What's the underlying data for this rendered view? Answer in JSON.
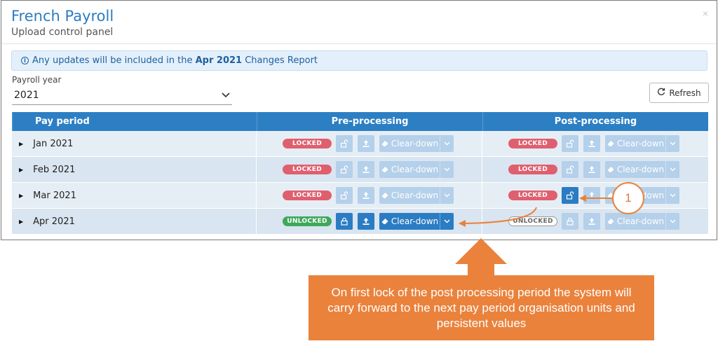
{
  "window": {
    "title": "French Payroll",
    "subtitle": "Upload control panel",
    "close_glyph": "×"
  },
  "banner": {
    "icon": "info-icon",
    "prefix": "Any updates will be included in the",
    "period": "Apr 2021",
    "suffix": "Changes Report"
  },
  "payroll_year": {
    "label": "Payroll year",
    "value": "2021"
  },
  "refresh_label": "Refresh",
  "table": {
    "headers": [
      "Pay period",
      "Pre-processing",
      "Post-processing"
    ],
    "rows": [
      {
        "period": "Jan 2021",
        "pre": {
          "status": "LOCKED",
          "cleardown": "Clear-down"
        },
        "post": {
          "status": "LOCKED",
          "cleardown": "Clear-down"
        }
      },
      {
        "period": "Feb 2021",
        "pre": {
          "status": "LOCKED",
          "cleardown": "Clear-down"
        },
        "post": {
          "status": "LOCKED",
          "cleardown": "Clear-down"
        }
      },
      {
        "period": "Mar 2021",
        "pre": {
          "status": "LOCKED",
          "cleardown": "Clear-down"
        },
        "post": {
          "status": "LOCKED",
          "cleardown": "Clear-down",
          "cleardown_partial": "own"
        }
      },
      {
        "period": "Apr 2021",
        "pre": {
          "status": "UNLOCKED",
          "cleardown": "Clear-down"
        },
        "post": {
          "status": "UNLOCKED",
          "cleardown": "Clear-down"
        }
      }
    ]
  },
  "annotation": {
    "marker": "1",
    "note": "On first lock of the post processing period the system will carry forward to the next pay period organisation units and persistent values"
  },
  "colors": {
    "accent": "#2d7fc4",
    "locked": "#e05f6e",
    "unlocked": "#3fa85a",
    "annotation": "#ea823c"
  }
}
